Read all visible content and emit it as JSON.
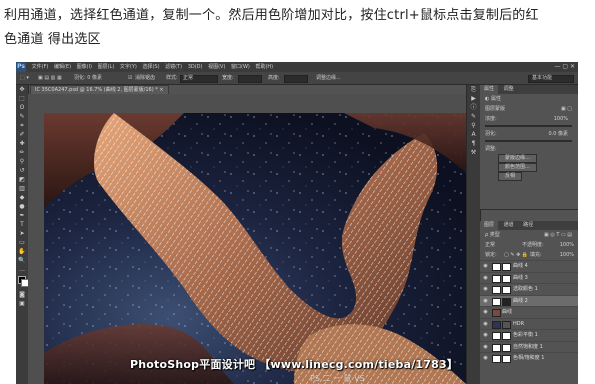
{
  "caption": {
    "line1": "利用通道，选择红色通道，复制一个。然后用色阶增加对比，按住ctrl+鼠标点击复制后的红",
    "line2": "色通道 得出选区"
  },
  "app": {
    "logo": "Ps",
    "menu": [
      "文件(F)",
      "编辑(E)",
      "图像(I)",
      "图层(L)",
      "文字(Y)",
      "选择(S)",
      "滤镜(T)",
      "3D(D)",
      "视图(V)",
      "窗口(W)",
      "帮助(H)"
    ],
    "window_buttons": "— ▢ ✕",
    "options": {
      "feather_label": "羽化: 0 像素",
      "antialias_label": "消除锯齿",
      "style_label": "样式:",
      "style_value": "正常",
      "width_label": "宽度:",
      "height_label": "高度:",
      "refine_label": "调整边缘...",
      "workspace": "基本功能"
    },
    "doc_tab": "IC 35C0A247.psd @ 16.7% (曲线 2, 图层蒙版/16) * ×",
    "properties": {
      "tabs": [
        "属性",
        "调整"
      ],
      "title": "属性",
      "mask_label": "图层蒙版",
      "density_label": "浓度:",
      "density_value": "100%",
      "feather_label": "羽化:",
      "feather_value": "0.0 像素",
      "refine_label": "调整:",
      "edge_button": "蒙版边缘...",
      "color_button": "颜色范围...",
      "invert_button": "反相"
    },
    "layers": {
      "tabs": [
        "图层",
        "通道",
        "路径"
      ],
      "kind": "ρ 类型",
      "blend": "正常",
      "opacity_label": "不透明度:",
      "opacity_value": "100%",
      "lock_label": "锁定:",
      "fill_label": "填充:",
      "fill_value": "100%",
      "items": [
        "曲线 4",
        "曲线 3",
        "选取颜色 1",
        "曲线 2",
        "曲线",
        "HDR",
        "色彩平衡 1",
        "自然饱和度 1",
        "色相/饱和度 1"
      ]
    }
  },
  "watermark": {
    "main": "PhotoShop平面设计吧 【www.linecg.com/tieba/1783】",
    "sub": "PS 二 一 鼠 VS"
  },
  "colors": {
    "app_bg": "#535353",
    "panel_dark": "#3c3c3c",
    "ps_blue": "#2e4f78",
    "selected_layer": "#6c6c6c"
  }
}
